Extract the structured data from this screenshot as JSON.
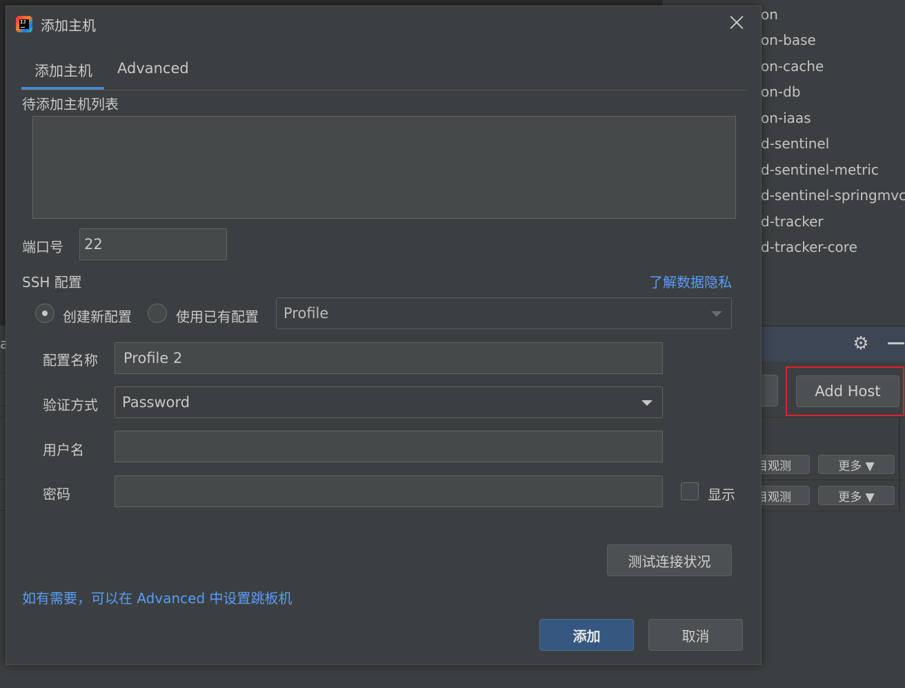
{
  "background": {
    "tree_items": [
      "on",
      "on-base",
      "on-cache",
      "on-db",
      "on-iaas",
      "d-sentinel",
      "d-sentinel-metric",
      "d-sentinel-springmvc",
      "d-tracker",
      "d-tracker-core"
    ],
    "left_glyph": "a",
    "add_host_label": "Add Host",
    "rows": [
      {
        "left_label": "目观测",
        "more_label": "更多 ▼"
      },
      {
        "left_label": "目观测",
        "more_label": "更多 ▼"
      }
    ]
  },
  "dialog": {
    "app_icon_text": "IJ",
    "title": "添加主机",
    "tabs": [
      {
        "label": "添加主机",
        "active": true
      },
      {
        "label": "Advanced",
        "active": false
      }
    ],
    "host_list_label": "待添加主机列表",
    "port_label": "端口号",
    "port_value": "22",
    "ssh_label": "SSH 配置",
    "privacy_link": "了解数据隐私",
    "radio_new_label": "创建新配置",
    "radio_existing_label": "使用已有配置",
    "radio_selected": "new",
    "profile_select_value": "Profile",
    "config_name_label": "配置名称",
    "config_name_value": "Profile 2",
    "auth_label": "验证方式",
    "auth_value": "Password",
    "username_label": "用户名",
    "username_value": "",
    "password_label": "密码",
    "password_value": "",
    "show_label": "显示",
    "test_button": "测试连接状况",
    "hint_link": "如有需要，可以在 Advanced 中设置跳板机",
    "add_button": "添加",
    "cancel_button": "取消"
  },
  "colors": {
    "accent": "#4a88c7",
    "link": "#589df6",
    "primary_button": "#365880",
    "highlight": "#e0212a"
  }
}
